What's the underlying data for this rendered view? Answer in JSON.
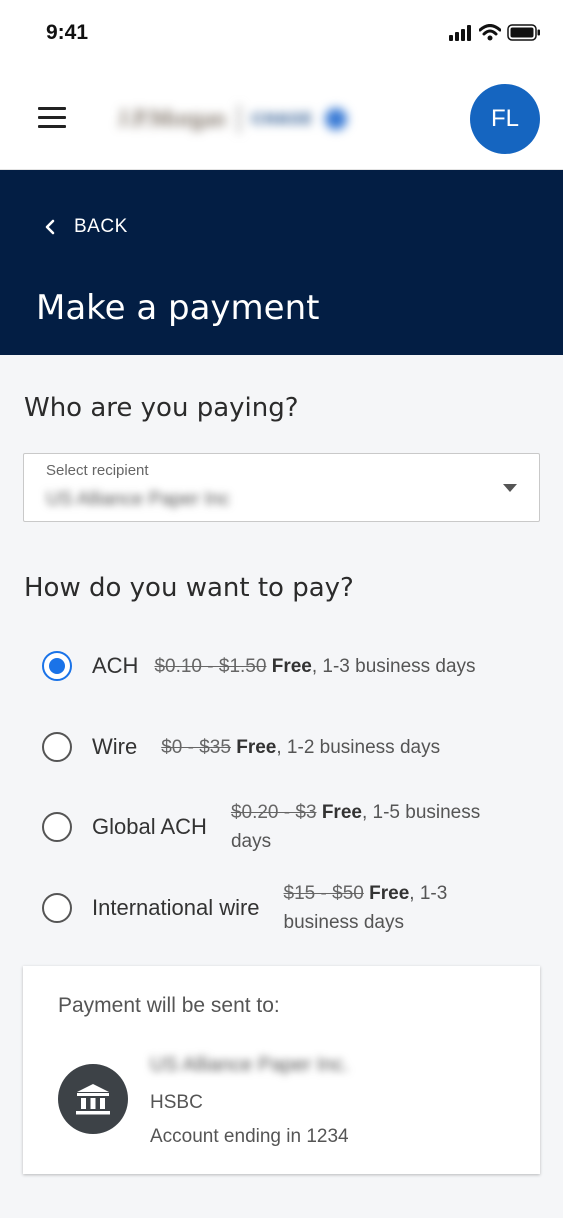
{
  "status_bar": {
    "time": "9:41"
  },
  "header": {
    "logo_primary": "J.P.Morgan",
    "logo_secondary": "CHASE",
    "avatar_initials": "FL",
    "brand_color": "#1565c0"
  },
  "page": {
    "back_label": "BACK",
    "title": "Make a payment",
    "header_color": "#031e44"
  },
  "recipient": {
    "heading": "Who are you paying?",
    "select_label": "Select recipient",
    "select_value": "US Alliance Paper Inc"
  },
  "payment_method": {
    "heading": "How do you want to pay?",
    "options": [
      {
        "label": "ACH",
        "old_price": "$0.10 - $1.50",
        "free": "Free",
        "rest": ", 1-3 business days",
        "selected": true
      },
      {
        "label": "Wire",
        "old_price": "$0 - $35",
        "free": "Free",
        "rest": ", 1-2 business days",
        "selected": false
      },
      {
        "label": "Global ACH",
        "old_price": "$0.20 - $3",
        "free": "Free",
        "rest": ", 1-5 business days",
        "selected": false
      },
      {
        "label": "International wire",
        "old_price": "$15 - $50",
        "free": "Free",
        "rest": ", 1-3 business days",
        "selected": false
      }
    ],
    "accent_color": "#1a73e8"
  },
  "destination": {
    "title": "Payment will be sent to:",
    "payee": "US Alliance Paper Inc.",
    "bank": "HSBC",
    "account": "Account ending in 1234",
    "icon": "bank-icon"
  }
}
